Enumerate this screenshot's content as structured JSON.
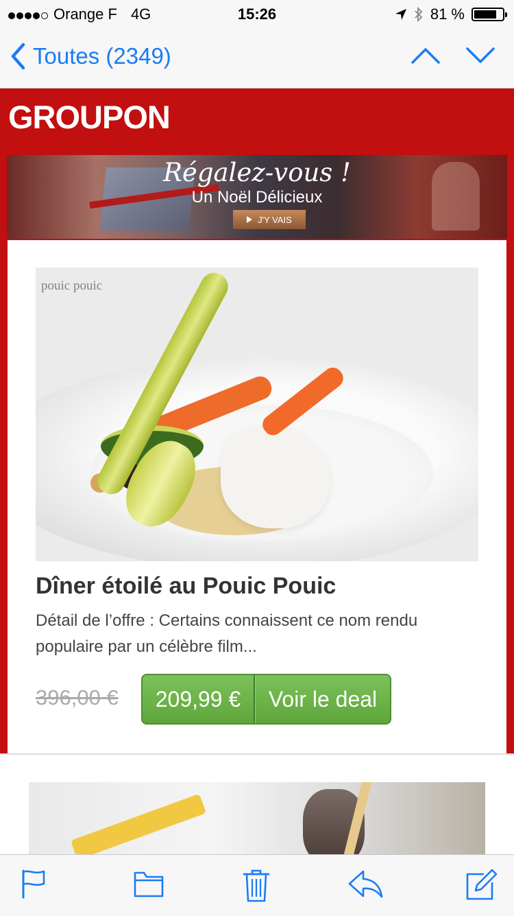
{
  "status_bar": {
    "carrier": "Orange F",
    "network": "4G",
    "time": "15:26",
    "battery": "81 %",
    "battery_level": 0.81,
    "signal_bars": 4
  },
  "nav": {
    "back_label": "Toutes (2349)",
    "accent_color": "#1a7cf5"
  },
  "email": {
    "logo": "GROUPON",
    "brand_color": "#c20f0f",
    "banner": {
      "line1": "Régalez-vous !",
      "line2": "Un Noël Délicieux",
      "button": "J'Y VAIS"
    },
    "deal": {
      "photo_brand": "pouic pouic",
      "title": "Dîner étoilé au Pouic Pouic",
      "description": "Détail de l’offre : Certains connaissent ce nom rendu populaire par un célèbre film...",
      "old_price": "396,00 €",
      "price": "209,99 €",
      "cta": "Voir le deal"
    }
  },
  "toolbar": {
    "icons": [
      "flag-icon",
      "folder-icon",
      "trash-icon",
      "reply-icon",
      "compose-icon"
    ]
  }
}
